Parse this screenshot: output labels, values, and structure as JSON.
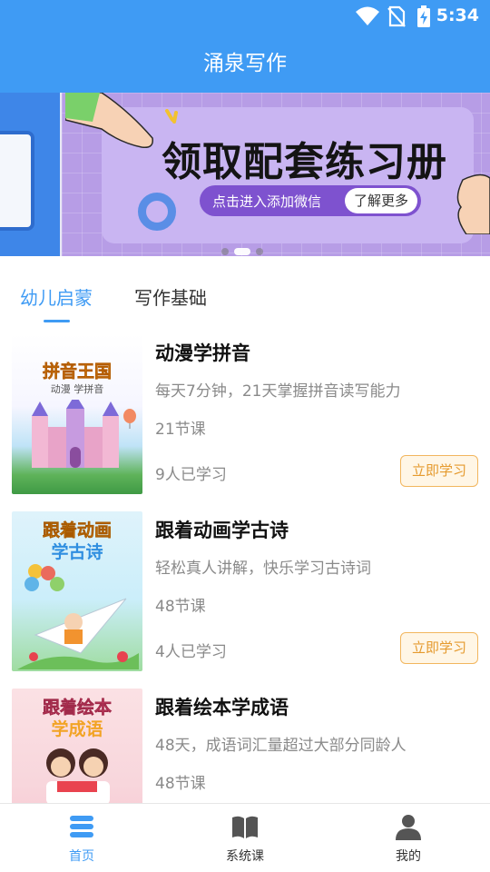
{
  "status_bar": {
    "time": "5:34"
  },
  "app_bar": {
    "title": "涌泉写作"
  },
  "banner": {
    "heading": "领取配套练习册",
    "pill_text": "点击进入添加微信",
    "pill_button": "了解更多",
    "slide_count": 3,
    "active_slide": 2
  },
  "tabs": [
    {
      "label": "幼儿启蒙",
      "active": true
    },
    {
      "label": "写作基础",
      "active": false
    }
  ],
  "courses": [
    {
      "title": "动漫学拼音",
      "description": "每天7分钟，21天掌握拼音读写能力",
      "lessons": "21节课",
      "students": "9人已学习",
      "button": "立即学习",
      "cover_text": [
        "拼音王国",
        "动漫 学拼音"
      ]
    },
    {
      "title": "跟着动画学古诗",
      "description": "轻松真人讲解，快乐学习古诗词",
      "lessons": "48节课",
      "students": "4人已学习",
      "button": "立即学习",
      "cover_text": [
        "跟着动画",
        "学古诗"
      ]
    },
    {
      "title": "跟着绘本学成语",
      "description": "48天，成语词汇量超过大部分同龄人",
      "lessons": "48节课",
      "cover_text": [
        "跟着绘本",
        "学成语"
      ]
    }
  ],
  "bottom_nav": [
    {
      "label": "首页",
      "icon": "home-stack-icon",
      "active": true
    },
    {
      "label": "系统课",
      "icon": "book-icon",
      "active": false
    },
    {
      "label": "我的",
      "icon": "person-icon",
      "active": false
    }
  ],
  "colors": {
    "primary": "#3f9bf4",
    "accent_orange": "#e59a2e",
    "banner_purple": "#b79de6"
  }
}
